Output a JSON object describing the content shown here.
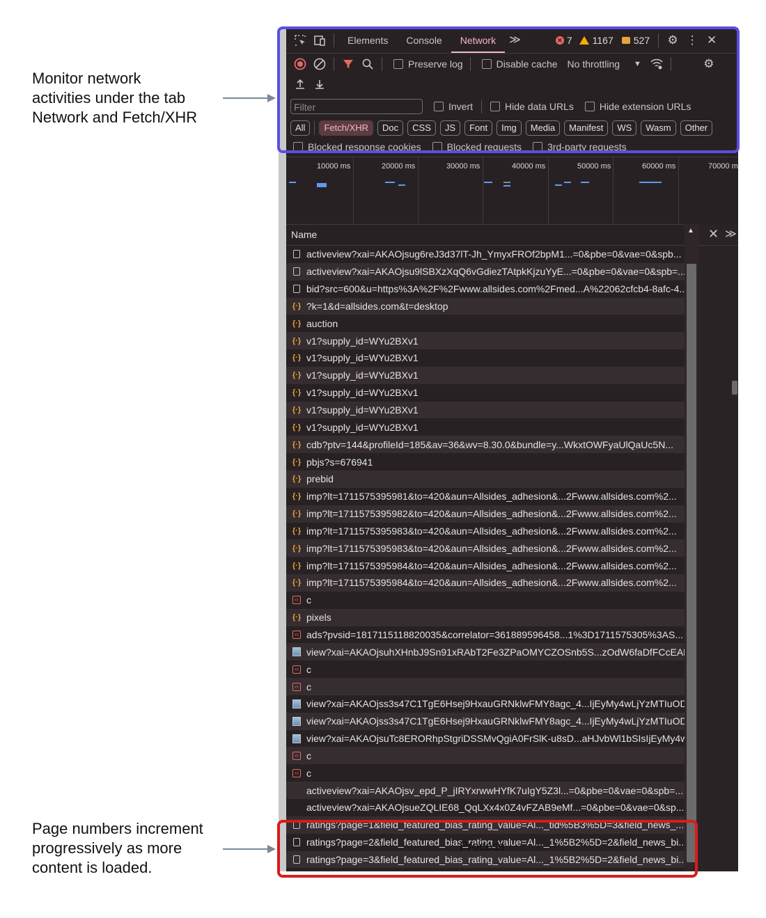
{
  "annotations": {
    "top": "Monitor network\nactivities under the tab\nNetwork and Fetch/XHR",
    "bottom": "Page numbers increment\nprogressively as more\ncontent is loaded."
  },
  "devtools": {
    "tabs": [
      "Elements",
      "Console",
      "Network"
    ],
    "more_tabs": "≫",
    "errors": "7",
    "warnings": "1167",
    "messages": "527",
    "toolbar": {
      "preserve_log": "Preserve log",
      "disable_cache": "Disable cache",
      "throttling": "No throttling"
    },
    "filter": {
      "placeholder": "Filter",
      "invert": "Invert",
      "hide_data_urls": "Hide data URLs",
      "hide_extension_urls": "Hide extension URLs"
    },
    "types": [
      "All",
      "Fetch/XHR",
      "Doc",
      "CSS",
      "JS",
      "Font",
      "Img",
      "Media",
      "Manifest",
      "WS",
      "Wasm",
      "Other"
    ],
    "active_type": "Fetch/XHR",
    "blocked": {
      "cookies": "Blocked response cookies",
      "requests": "Blocked requests",
      "third_party": "3rd-party requests"
    },
    "timeline_labels": [
      "10000 ms",
      "20000 ms",
      "30000 ms",
      "40000 ms",
      "50000 ms",
      "60000 ms",
      "70000 m"
    ],
    "name_header": "Name",
    "requests": [
      {
        "icon": "doc",
        "name": "activeview?xai=AKAOjsug6reJ3d37lT-Jh_YmyxFROf2bpM1...=0&pbe=0&vae=0&spb..."
      },
      {
        "icon": "doc",
        "name": "activeview?xai=AKAOjsu9lSBXzXqQ6vGdiezTAtpkKjzuYyE...=0&pbe=0&vae=0&spb=..."
      },
      {
        "icon": "doc",
        "name": "bid?src=600&u=https%3A%2F%2Fwww.allsides.com%2Fmed...A%22062cfcb4-8afc-4..."
      },
      {
        "icon": "xhr",
        "name": "?k=1&d=allsides.com&t=desktop"
      },
      {
        "icon": "xhr",
        "name": "auction"
      },
      {
        "icon": "xhr",
        "name": "v1?supply_id=WYu2BXv1"
      },
      {
        "icon": "xhr",
        "name": "v1?supply_id=WYu2BXv1"
      },
      {
        "icon": "xhr",
        "name": "v1?supply_id=WYu2BXv1"
      },
      {
        "icon": "xhr",
        "name": "v1?supply_id=WYu2BXv1"
      },
      {
        "icon": "xhr",
        "name": "v1?supply_id=WYu2BXv1"
      },
      {
        "icon": "xhr",
        "name": "v1?supply_id=WYu2BXv1"
      },
      {
        "icon": "xhr",
        "name": "cdb?ptv=144&profileId=185&av=36&wv=8.30.0&bundle=y...WkxtOWFyaUlQaUc5N..."
      },
      {
        "icon": "xhr",
        "name": "pbjs?s=676941"
      },
      {
        "icon": "xhr",
        "name": "prebid"
      },
      {
        "icon": "xhr",
        "name": "imp?lt=1711575395981&to=420&aun=Allsides_adhesion&...2Fwww.allsides.com%2..."
      },
      {
        "icon": "xhr",
        "name": "imp?lt=1711575395982&to=420&aun=Allsides_adhesion&...2Fwww.allsides.com%2..."
      },
      {
        "icon": "xhr",
        "name": "imp?lt=1711575395983&to=420&aun=Allsides_adhesion&...2Fwww.allsides.com%2..."
      },
      {
        "icon": "xhr",
        "name": "imp?lt=1711575395983&to=420&aun=Allsides_adhesion&...2Fwww.allsides.com%2..."
      },
      {
        "icon": "xhr",
        "name": "imp?lt=1711575395984&to=420&aun=Allsides_adhesion&...2Fwww.allsides.com%2..."
      },
      {
        "icon": "xhr",
        "name": "imp?lt=1711575395984&to=420&aun=Allsides_adhesion&...2Fwww.allsides.com%2..."
      },
      {
        "icon": "script",
        "name": "c"
      },
      {
        "icon": "xhr",
        "name": "pixels"
      },
      {
        "icon": "script",
        "name": "ads?pvsid=1817115118820035&correlator=361889596458...1%3D1711575305%3AS..."
      },
      {
        "icon": "img",
        "name": "view?xai=AKAOjsuhXHnbJ9Sn91xRAbT2Fe3ZPaOMYCZOSnb5S...zOdW6faDfFCcEAE..."
      },
      {
        "icon": "script",
        "name": "c"
      },
      {
        "icon": "script",
        "name": "c"
      },
      {
        "icon": "img",
        "name": "view?xai=AKAOjss3s47C1TgE6Hsej9HxauGRNklwFMY8agc_4...IjEyMy4wLjYzMTIuODY..."
      },
      {
        "icon": "img",
        "name": "view?xai=AKAOjss3s47C1TgE6Hsej9HxauGRNklwFMY8agc_4...IjEyMy4wLjYzMTIuODY..."
      },
      {
        "icon": "img",
        "name": "view?xai=AKAOjsuTc8ERORhpStgriDSSMvQgiA0FrSlK-u8sD...aHJvbWl1bSIsIjEyMy4w..."
      },
      {
        "icon": "script",
        "name": "c"
      },
      {
        "icon": "script",
        "name": "c"
      },
      {
        "icon": "none",
        "name": "activeview?xai=AKAOjsv_epd_P_jIRYxrwwHYfK7uIgY5Z3l...=0&pbe=0&vae=0&spb=..."
      },
      {
        "icon": "none",
        "name": "activeview?xai=AKAOjsueZQLIE68_QqLXx4x0Z4vFZAB9eMf...=0&pbe=0&vae=0&sp..."
      },
      {
        "icon": "doc",
        "name": "ratings?page=1&field_featured_bias_rating_value=Al..._tid%5B3%5D=3&field_news_..."
      },
      {
        "icon": "doc",
        "name": "ratings?page=2&field_featured_bias_rating_value=Al..._1%5B2%5D=2&field_news_bi..."
      },
      {
        "icon": "doc",
        "name": "ratings?page=3&field_featured_bias_rating_value=Al..._1%5B2%5D=2&field_news_bi..."
      }
    ],
    "overlay_text": "Process"
  },
  "colors": {
    "network_box": "#5a4fe0",
    "ratings_box": "#d81b1b",
    "accent": "#f2b8c6"
  }
}
